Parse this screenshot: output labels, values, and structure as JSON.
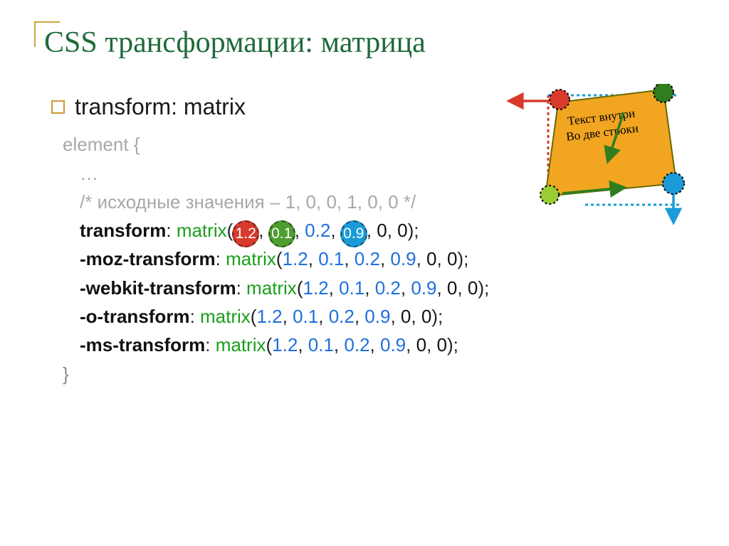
{
  "title": "CSS трансформации: матрица",
  "bullet": "transform: matrix",
  "code": {
    "selector": "element {",
    "ellipsis": "…",
    "comment": "/* исходные значения – 1, 0, 0, 1, 0, 0 */",
    "close": "}",
    "func": "matrix",
    "args": {
      "a": "1.2",
      "b": "0.1",
      "c": "0.2",
      "d": "0.9",
      "e": "0",
      "f": "0"
    },
    "lines": [
      {
        "prop": "transform",
        "highlight": true
      },
      {
        "prop": "-moz-transform",
        "highlight": false
      },
      {
        "prop": "-webkit-transform",
        "highlight": false
      },
      {
        "prop": "-o-transform",
        "highlight": false
      },
      {
        "prop": "-ms-transform",
        "highlight": false
      }
    ]
  },
  "diagram": {
    "note_line1": "Текст внутри",
    "note_line2": "Во две строки",
    "colors": {
      "red": "#d83a2b",
      "green_dark": "#2f7d1e",
      "green_light": "#9acd32",
      "blue": "#1a9bd7",
      "note_fill": "#f1a521",
      "note_stroke": "#6a6a00"
    }
  }
}
